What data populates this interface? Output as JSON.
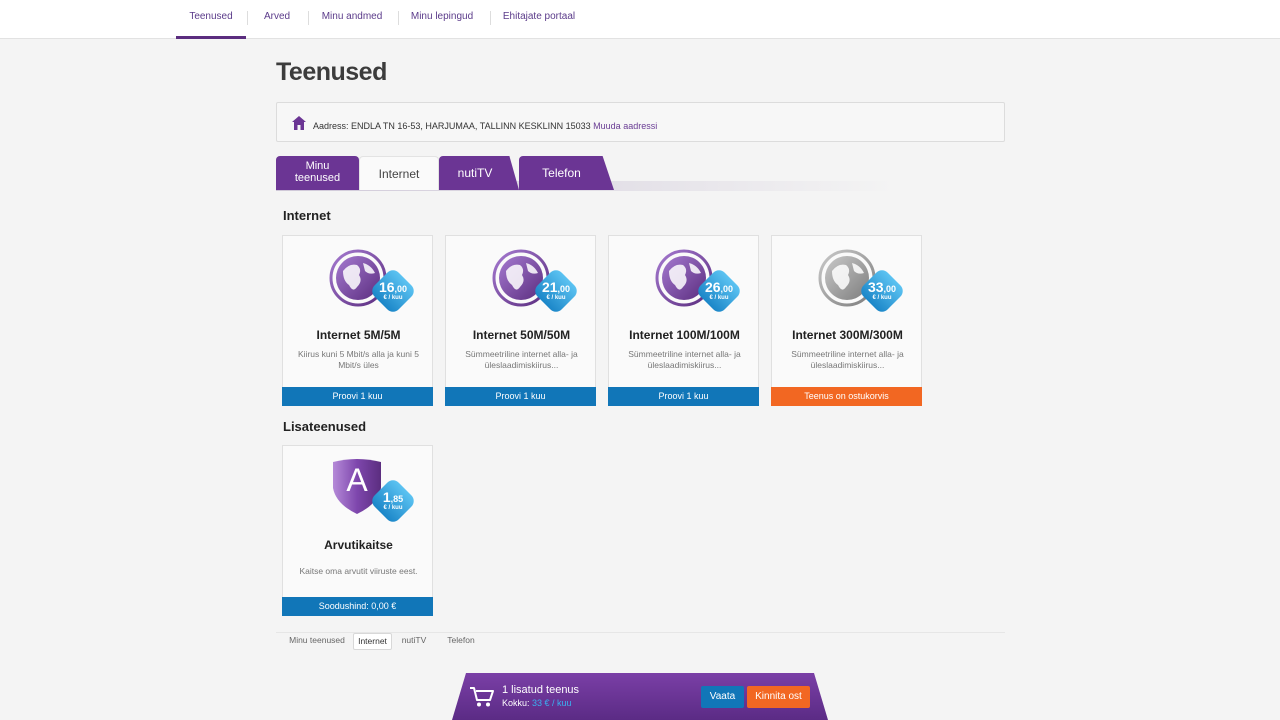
{
  "nav": {
    "items": [
      "Teenused",
      "Arved",
      "Minu andmed",
      "Minu lepingud",
      "Ehitajate portaal"
    ]
  },
  "page": {
    "title": "Teenused"
  },
  "address": {
    "label": "Aadress:",
    "value": "ENDLA TN 16-53, HARJUMAA, TALLINN KESKLINN 15033",
    "change_link": "Muuda aadressi"
  },
  "tabs": {
    "my_services_line1": "Minu",
    "my_services_line2": "teenused",
    "internet": "Internet",
    "nutitv": "nutiTV",
    "telefon": "Telefon"
  },
  "sections": {
    "internet": "Internet",
    "extras": "Lisateenused"
  },
  "internet_cards": [
    {
      "price_int": "16",
      "price_dec": ",00",
      "unit": "€ / kuu",
      "name": "Internet 5M/5M",
      "desc": "Kiirus kuni 5 Mbit/s alla ja kuni 5 Mbit/s üles",
      "button": "Proovi 1 kuu"
    },
    {
      "price_int": "21",
      "price_dec": ",00",
      "unit": "€ / kuu",
      "name": "Internet 50M/50M",
      "desc": "Sümmeetriline internet alla- ja üleslaadimiskiirus...",
      "button": "Proovi 1 kuu"
    },
    {
      "price_int": "26",
      "price_dec": ",00",
      "unit": "€ / kuu",
      "name": "Internet 100M/100M",
      "desc": "Sümmeetriline internet alla- ja üleslaadimiskiirus...",
      "button": "Proovi 1 kuu"
    },
    {
      "price_int": "33",
      "price_dec": ",00",
      "unit": "€ / kuu",
      "name": "Internet 300M/300M",
      "desc": "Sümmeetriline internet alla- ja üleslaadimiskiirus...",
      "button": "Teenus on ostukorvis"
    }
  ],
  "extra_card": {
    "icon_letter": "A",
    "price_int": "1",
    "price_dec": ",85",
    "unit": "€ / kuu",
    "name": "Arvutikaitse",
    "desc": "Kaitse oma arvutit viiruste eest.",
    "button": "Soodushind: 0,00 €"
  },
  "bottom_tabs": [
    "Minu teenused",
    "Internet",
    "nutiTV",
    "Telefon"
  ],
  "cart": {
    "count_text": "1 lisatud teenus",
    "total_label": "Kokku:",
    "total_value": "33 € / kuu",
    "view_button": "Vaata",
    "confirm_button": "Kinnita ost"
  },
  "colors": {
    "brand_purple": "#6b3594",
    "button_blue": "#1176b8",
    "button_orange": "#f26722",
    "badge_blue": "#2f9fd9"
  }
}
